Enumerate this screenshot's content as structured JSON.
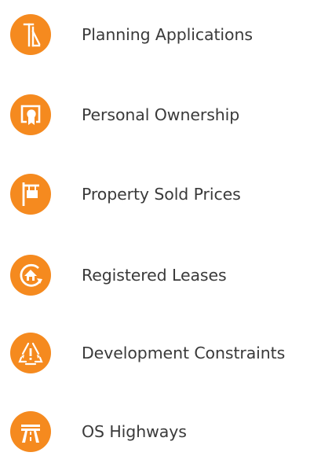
{
  "features": {
    "items": [
      {
        "label": "Planning Applications",
        "icon": "planning-icon"
      },
      {
        "label": "Personal Ownership",
        "icon": "certificate-icon"
      },
      {
        "label": "Property Sold Prices",
        "icon": "sold-sign-icon"
      },
      {
        "label": "Registered Leases",
        "icon": "house-cycle-icon"
      },
      {
        "label": "Development Constraints",
        "icon": "warning-triangle-icon"
      },
      {
        "label": "OS Highways",
        "icon": "motorway-icon"
      }
    ]
  },
  "colors": {
    "accent": "#f58a1f",
    "text": "#3a3a3a",
    "icon_glyph": "#ffffff"
  }
}
